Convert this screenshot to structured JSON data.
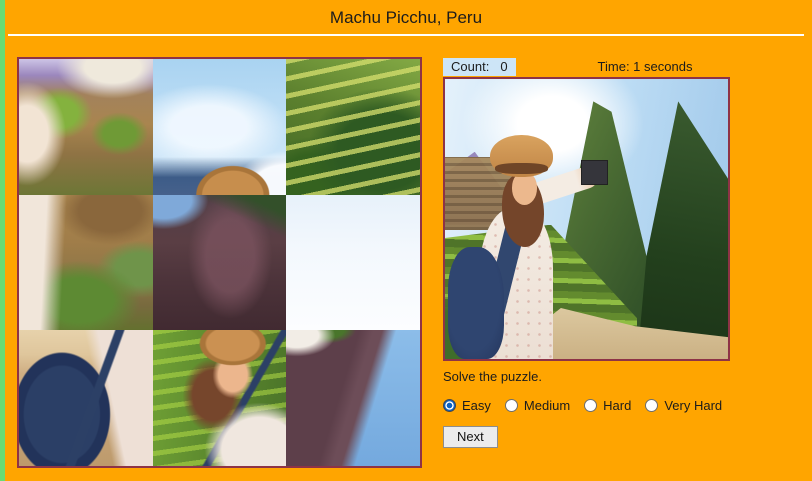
{
  "theme": {
    "background": "#FFA500",
    "edge_stripe_green": "#69DC73",
    "frame_border_maroon": "#8E3346",
    "count_badge_bg": "#CDE5F7",
    "radio_selected_blue": "#0F62BE",
    "divider_white": "#FFFFFF"
  },
  "header": {
    "title": "Machu Picchu, Peru"
  },
  "stats": {
    "count_label": "Count:",
    "count_value": "0",
    "time_text": "Time: 1 seconds"
  },
  "puzzle": {
    "grid_size": "3x3",
    "tiles": [
      {
        "name": "person-photographing-ruins-top"
      },
      {
        "name": "sky-cloud-with-hat-brim"
      },
      {
        "name": "green-terraces-and-trees"
      },
      {
        "name": "person-sleeve-ruins-stairs"
      },
      {
        "name": "dark-cliff-face"
      },
      {
        "name": "pale-sky"
      },
      {
        "name": "navy-backpack-floral-dress"
      },
      {
        "name": "woman-face-with-hat"
      },
      {
        "name": "mountain-slope-blue-sky"
      }
    ]
  },
  "reference": {
    "name": "solved-machu-picchu-photo"
  },
  "controls": {
    "instruction": "Solve the puzzle.",
    "difficulty_options": [
      {
        "label": "Easy",
        "selected": true
      },
      {
        "label": "Medium",
        "selected": false
      },
      {
        "label": "Hard",
        "selected": false
      },
      {
        "label": "Very Hard",
        "selected": false
      }
    ],
    "next_button": "Next"
  }
}
